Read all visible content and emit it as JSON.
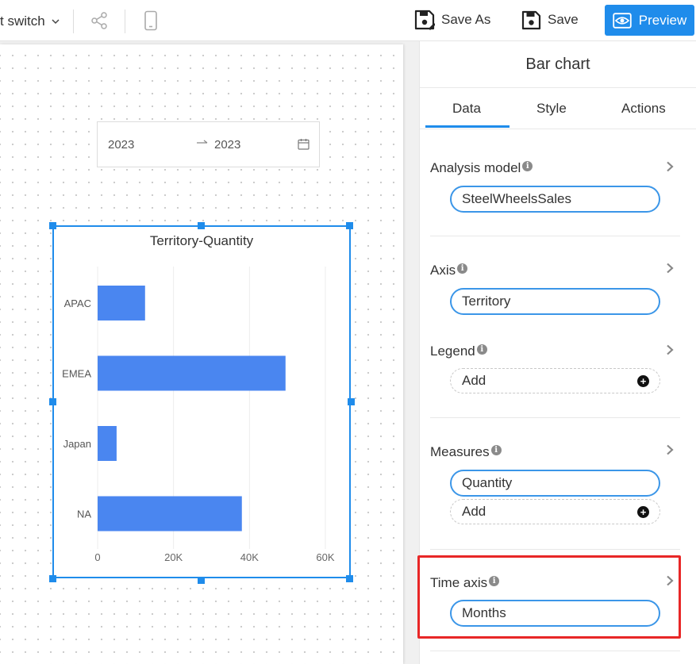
{
  "toolbar": {
    "switch_label": "t switch",
    "save_as_label": "Save As",
    "save_label": "Save",
    "preview_label": "Preview",
    "icons": [
      "chevron-down-icon",
      "share-icon",
      "mobile-icon",
      "save-as-icon",
      "save-icon",
      "eye-icon"
    ]
  },
  "canvas": {
    "date_range": {
      "from": "2023",
      "to": "2023"
    }
  },
  "chart_data": {
    "type": "bar",
    "orientation": "horizontal",
    "title": "Territory-Quantity",
    "categories": [
      "APAC",
      "EMEA",
      "Japan",
      "NA"
    ],
    "values": [
      12500,
      49500,
      5000,
      38000
    ],
    "x_ticks": [
      "0",
      "20K",
      "40K",
      "60K"
    ],
    "xlim": [
      0,
      60000
    ],
    "grid": true,
    "color": "#4a86f0"
  },
  "panel": {
    "title": "Bar chart",
    "tabs": [
      "Data",
      "Style",
      "Actions"
    ],
    "active_tab": "Data",
    "analysis_model": {
      "label": "Analysis model",
      "value": "SteelWheelsSales"
    },
    "axis": {
      "label": "Axis",
      "value": "Territory"
    },
    "legend": {
      "label": "Legend",
      "add_label": "Add"
    },
    "measures": {
      "label": "Measures",
      "value": "Quantity",
      "add_label": "Add"
    },
    "time_axis": {
      "label": "Time axis",
      "value": "Months"
    }
  },
  "colors": {
    "accent": "#1f8ceb",
    "highlight": "#e82727"
  }
}
